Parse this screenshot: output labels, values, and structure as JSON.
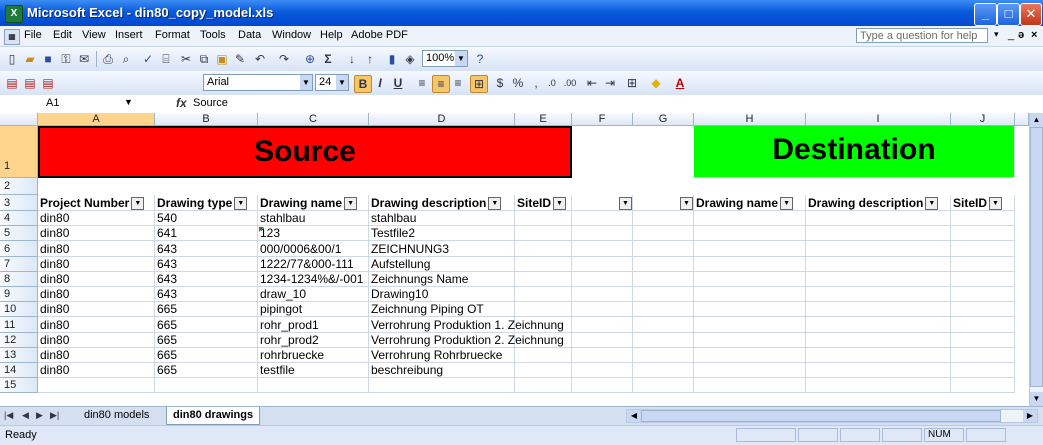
{
  "window": {
    "title": "Microsoft Excel - din80_copy_model.xls"
  },
  "menu": {
    "items": [
      "File",
      "Edit",
      "View",
      "Insert",
      "Format",
      "Tools",
      "Data",
      "Window",
      "Help",
      "Adobe PDF"
    ],
    "help_placeholder": "Type a question for help"
  },
  "formatting": {
    "font": "Arial",
    "size": "24",
    "zoom": "100%"
  },
  "formula_bar": {
    "name_box": "A1",
    "fx": "fx",
    "value": "Source"
  },
  "columns": [
    "A",
    "B",
    "C",
    "D",
    "E",
    "F",
    "G",
    "H",
    "I",
    "J"
  ],
  "rows": [
    "1",
    "2",
    "3",
    "4",
    "5",
    "6",
    "7",
    "8",
    "9",
    "10",
    "11",
    "12",
    "13",
    "14",
    "15"
  ],
  "banners": {
    "source": {
      "text": "Source",
      "color": "#ff0000"
    },
    "destination": {
      "text": "Destination",
      "color": "#00ff00"
    }
  },
  "headers": {
    "A": "Project Number",
    "B": "Drawing type",
    "C": "Drawing name",
    "D": "Drawing description",
    "E": "SiteID",
    "H": "Drawing name",
    "I": "Drawing description",
    "J": "SiteID"
  },
  "table": [
    [
      "din80",
      "540",
      "stahlbau",
      "stahlbau"
    ],
    [
      "din80",
      "641",
      "123",
      "Testfile2"
    ],
    [
      "din80",
      "643",
      "000/0006&00/1",
      "ZEICHNUNG3"
    ],
    [
      "din80",
      "643",
      "1222/77&000-111",
      "Aufstellung"
    ],
    [
      "din80",
      "643",
      "1234-1234%&/-001",
      "Zeichnungs Name"
    ],
    [
      "din80",
      "643",
      "draw_10",
      "Drawing10"
    ],
    [
      "din80",
      "665",
      "pipingot",
      "Zeichnung Piping OT"
    ],
    [
      "din80",
      "665",
      "rohr_prod1",
      "Verrohrung Produktion 1. Zeichnung"
    ],
    [
      "din80",
      "665",
      "rohr_prod2",
      "Verrohrung Produktion 2. Zeichnung"
    ],
    [
      "din80",
      "665",
      "rohrbruecke",
      "Verrohrung Rohrbruecke"
    ],
    [
      "din80",
      "665",
      "testfile",
      "beschreibung"
    ]
  ],
  "sheets": {
    "tab1": "din80 models",
    "tab2": "din80 drawings"
  },
  "status": {
    "text": "Ready",
    "num": "NUM"
  }
}
